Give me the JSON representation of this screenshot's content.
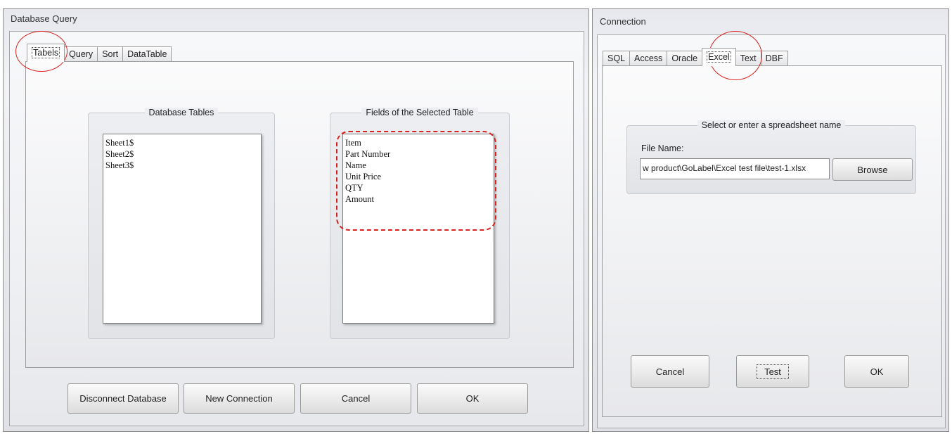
{
  "left_window": {
    "title": "Database Query",
    "tabs": [
      "Tabels",
      "Query",
      "Sort",
      "DataTable"
    ],
    "active_tab": "Tabels",
    "database_tables": {
      "title": "Database Tables",
      "items": [
        "Sheet1$",
        "Sheet2$",
        "Sheet3$"
      ]
    },
    "fields": {
      "title": "Fields of the Selected Table",
      "items": [
        "Item",
        "Part Number",
        "Name",
        "Unit Price",
        "QTY",
        "Amount"
      ]
    },
    "buttons": {
      "disconnect": "Disconnect Database",
      "new_connection": "New Connection",
      "cancel": "Cancel",
      "ok": "OK"
    }
  },
  "right_window": {
    "title": "Connection",
    "tabs": [
      "SQL",
      "Access",
      "Oracle",
      "Excel",
      "Text",
      "DBF"
    ],
    "active_tab": "Excel",
    "group_title": "Select or enter a spreadsheet name",
    "file_label": "File Name:",
    "file_value": "w product\\GoLabel\\Excel test file\\test-1.xlsx",
    "buttons": {
      "browse": "Browse",
      "cancel": "Cancel",
      "test": "Test",
      "ok": "OK"
    }
  },
  "annotation_color": "#d9231f"
}
